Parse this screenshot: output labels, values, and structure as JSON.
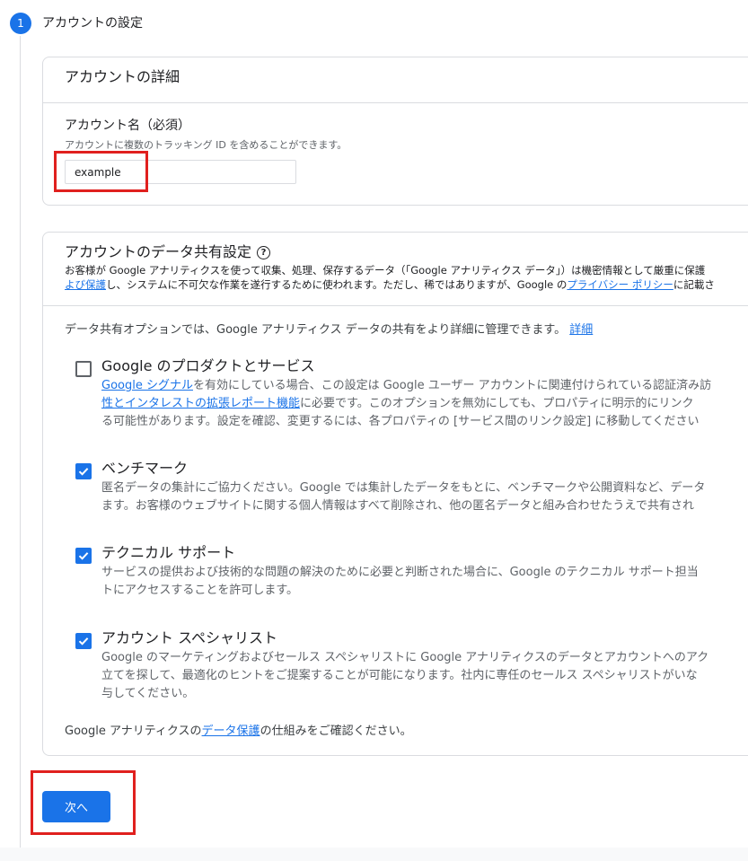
{
  "step": {
    "number": "1",
    "title": "アカウントの設定"
  },
  "account_details": {
    "title": "アカウントの詳細",
    "name_label": "アカウント名（必須）",
    "name_help": "アカウントに複数のトラッキング ID を含めることができます。",
    "name_value": "example"
  },
  "data_sharing": {
    "title": "アカウントのデータ共有設定",
    "description": {
      "line1": "お客様が Google アナリティクスを使って収集、処理、保存するデータ（「Google アナリティクス データ」）は機密情報として厳重に保護",
      "line2_link1": "よび保護",
      "line2_text": "し、システムに不可欠な作業を遂行するために使われます。ただし、稀ではありますが、Google の",
      "line2_link2": "プライバシー ポリシー",
      "line2_tail": "に記載さ"
    },
    "intro_text": "データ共有オプションでは、Google アナリティクス データの共有をより詳細に管理できます。",
    "intro_link": "詳細",
    "options": [
      {
        "title": "Google のプロダクトとサービス",
        "checked": false,
        "line1_link": "Google シグナル",
        "line1_text": "を有効にしている場合、この設定は Google ユーザー アカウントに関連付けられている認証済み訪",
        "line2_link": "性とインタレストの拡張レポート機能",
        "line2_text": "に必要です。このオプションを無効にしても、プロパティに明示的にリンク",
        "line3": "る可能性があります。設定を確認、変更するには、各プロパティの [サービス間のリンク設定] に移動してください"
      },
      {
        "title": "ベンチマーク",
        "checked": true,
        "line1": "匿名データの集計にご協力ください。Google では集計したデータをもとに、ベンチマークや公開資料など、データ",
        "line2": "ます。お客様のウェブサイトに関する個人情報はすべて削除され、他の匿名データと組み合わせたうえで共有され"
      },
      {
        "title": "テクニカル サポート",
        "checked": true,
        "line1": "サービスの提供および技術的な問題の解決のために必要と判断された場合に、Google のテクニカル サポート担当",
        "line2": "トにアクセスすることを許可します。"
      },
      {
        "title": "アカウント スペシャリスト",
        "checked": true,
        "line1": "Google のマーケティングおよびセールス スペシャリストに Google アナリティクスのデータとアカウントへのアク",
        "line2": "立てを探して、最適化のヒントをご提案することが可能になります。社内に専任のセールス スペシャリストがいな",
        "line3": "与してください。"
      }
    ],
    "footnote_pre": "Google アナリティクスの",
    "footnote_link": "データ保護",
    "footnote_post": "の仕組みをご確認ください。"
  },
  "next_button": "次へ",
  "colors": {
    "accent": "#1a73e8",
    "highlight": "#e0201e"
  }
}
